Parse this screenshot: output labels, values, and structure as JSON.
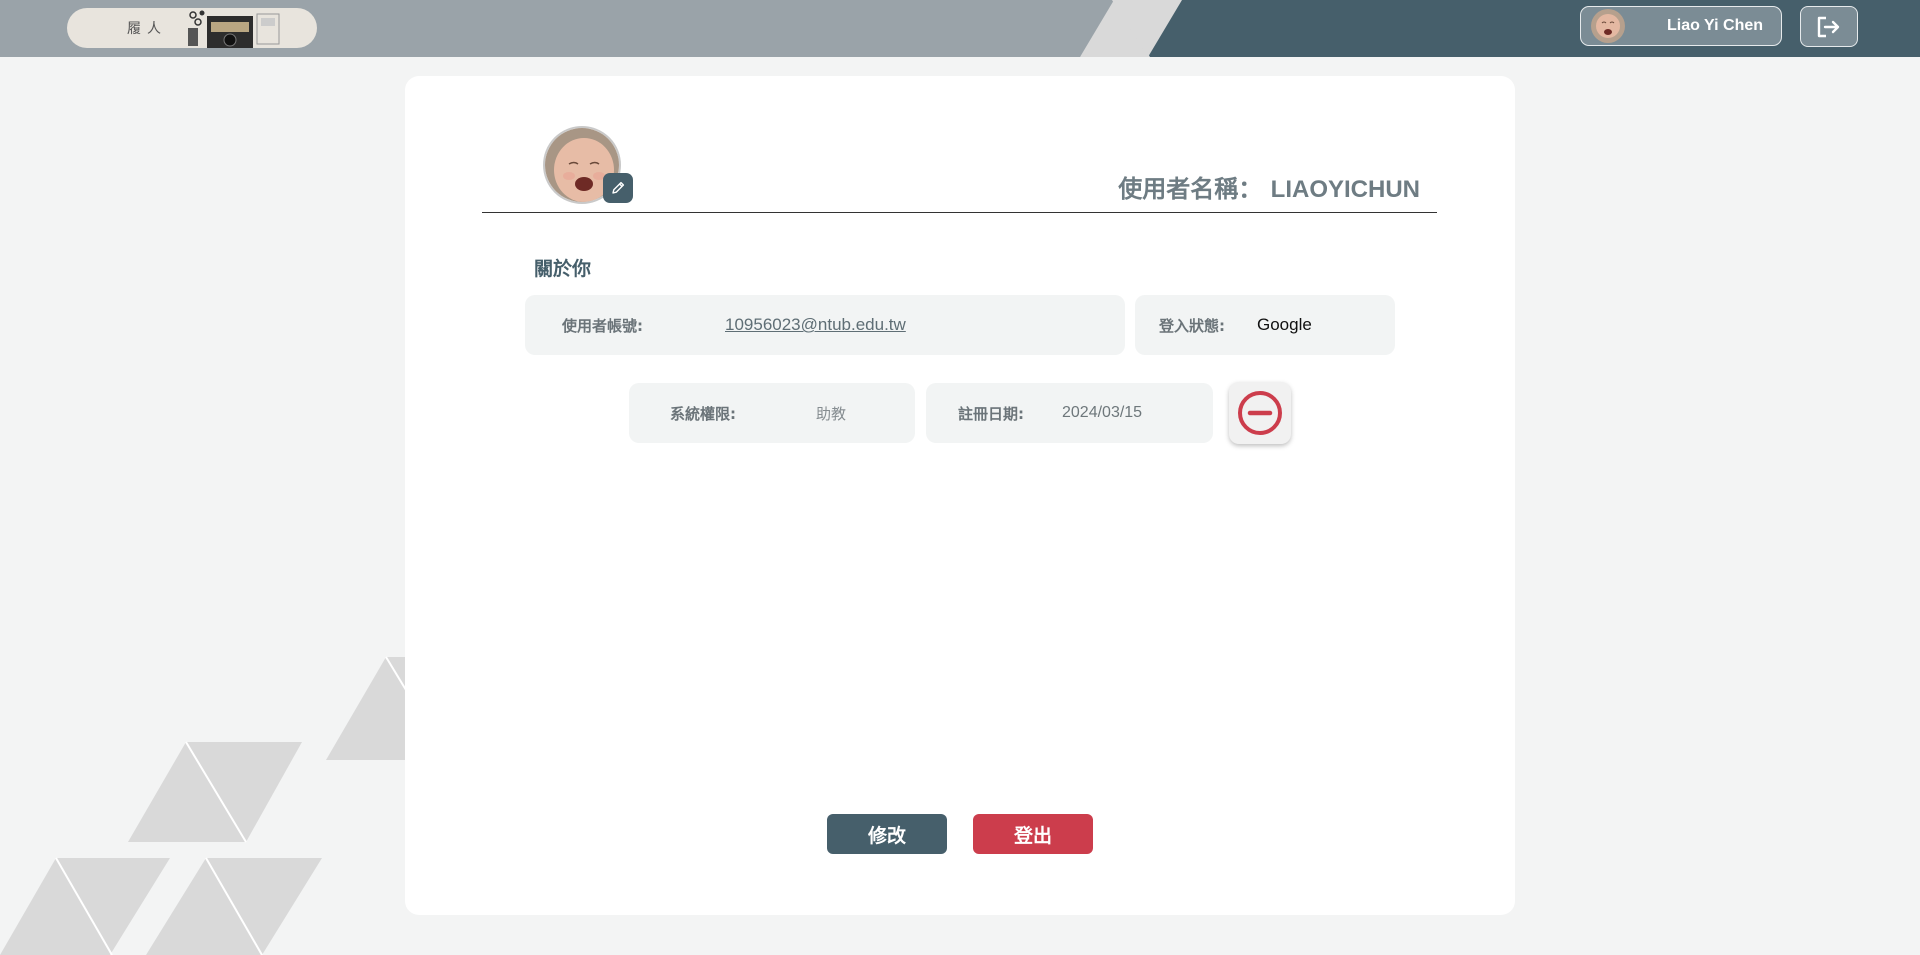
{
  "topbar": {
    "logo_text": "履人",
    "user_name": "Liao Yi Chen",
    "logout_icon": "logout-icon"
  },
  "profile": {
    "username_label": "使用者名稱：",
    "username_value": "LIAOYICHUN",
    "edit_avatar_icon": "pencil-icon",
    "section_title": "關於你",
    "account_label": "使用者帳號:",
    "account_value": "10956023@ntub.edu.tw",
    "login_label": "登入狀態:",
    "login_value": "Google",
    "role_label": "系統權限:",
    "role_value": "助教",
    "date_label": "註冊日期:",
    "date_value": "2024/03/15",
    "remove_icon": "minus-circle-icon"
  },
  "actions": {
    "edit_label": "修改",
    "logout_label": "登出"
  },
  "colors": {
    "topbar": "#9aa3a9",
    "accent_dark": "#465f6b",
    "danger": "#cc3d4c",
    "background": "#f3f4f4"
  }
}
